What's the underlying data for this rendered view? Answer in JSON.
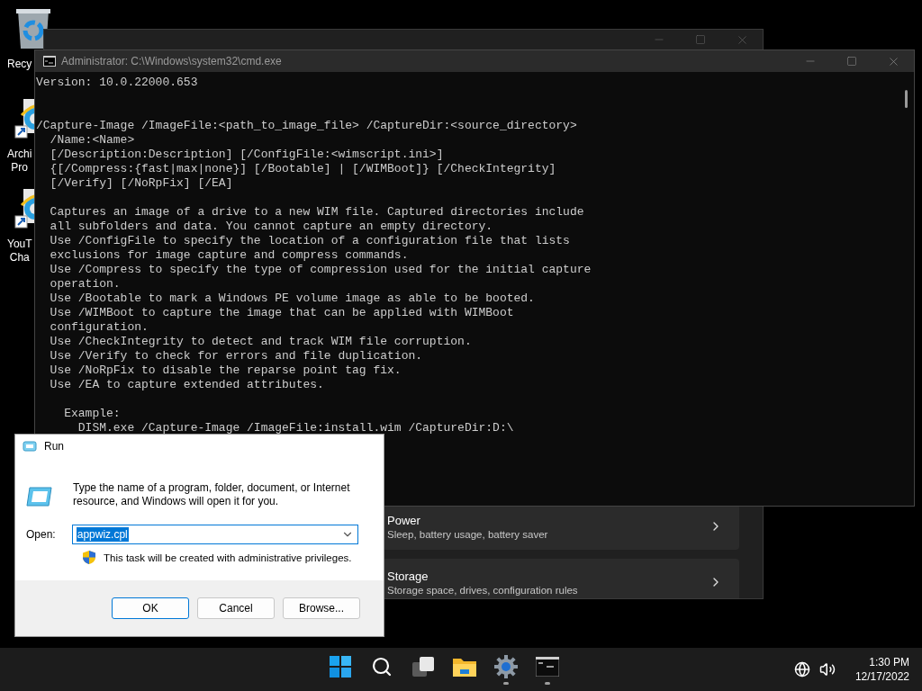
{
  "desktop_icons": [
    {
      "kind": "recycle-bin",
      "label_lines": [
        "Recy"
      ]
    },
    {
      "kind": "shortcut",
      "label_lines": [
        "Archi",
        "Pro"
      ]
    },
    {
      "kind": "shortcut",
      "label_lines": [
        "YouT",
        "Cha"
      ]
    }
  ],
  "settings_window": {
    "cards": [
      {
        "title": "Power",
        "subtitle": "Sleep, battery usage, battery saver"
      },
      {
        "title": "Storage",
        "subtitle": "Storage space, drives, configuration rules"
      }
    ]
  },
  "cmd_window": {
    "title": "Administrator: C:\\Windows\\system32\\cmd.exe",
    "blocks": [
      [
        "Version: 10.0.22000.653"
      ],
      [
        "/Capture-Image /ImageFile:<path_to_image_file> /CaptureDir:<source_directory>",
        "  /Name:<Name>",
        "  [/Description:Description] [/ConfigFile:<wimscript.ini>]",
        "  {[/Compress:{fast|max|none}] [/Bootable] | [/WIMBoot]} [/CheckIntegrity]",
        "  [/Verify] [/NoRpFix] [/EA]"
      ],
      [
        "  Captures an image of a drive to a new WIM file. Captured directories include",
        "  all subfolders and data. You cannot capture an empty directory.",
        "  Use /ConfigFile to specify the location of a configuration file that lists",
        "  exclusions for image capture and compress commands.",
        "  Use /Compress to specify the type of compression used for the initial capture",
        "  operation.",
        "  Use /Bootable to mark a Windows PE volume image as able to be booted.",
        "  Use /WIMBoot to capture the image that can be applied with WIMBoot",
        "  configuration.",
        "  Use /CheckIntegrity to detect and track WIM file corruption.",
        "  Use /Verify to check for errors and file duplication.",
        "  Use /NoRpFix to disable the reparse point tag fix.",
        "  Use /EA to capture extended attributes."
      ],
      [
        "    Example:",
        "      DISM.exe /Capture-Image /ImageFile:install.wim /CaptureDir:D:\\"
      ]
    ]
  },
  "run_dialog": {
    "title": "Run",
    "description": "Type the name of a program, folder, document, or Internet resource, and Windows will open it for you.",
    "open_label": "Open:",
    "value": "appwiz.cpl",
    "text_selected": true,
    "note": "This task will be created with administrative privileges.",
    "buttons": [
      {
        "label": "OK",
        "default": true
      },
      {
        "label": "Cancel",
        "default": false
      },
      {
        "label": "Browse...",
        "default": false
      }
    ]
  },
  "taskbar": {
    "apps": [
      {
        "kind": "start",
        "running": false
      },
      {
        "kind": "search",
        "running": false
      },
      {
        "kind": "task-view",
        "running": false
      },
      {
        "kind": "explorer",
        "running": false
      },
      {
        "kind": "settings",
        "running": true
      },
      {
        "kind": "terminal",
        "running": true
      }
    ],
    "tray": [
      {
        "kind": "network"
      },
      {
        "kind": "volume"
      }
    ],
    "time": "1:30 PM",
    "date": "12/17/2022"
  }
}
